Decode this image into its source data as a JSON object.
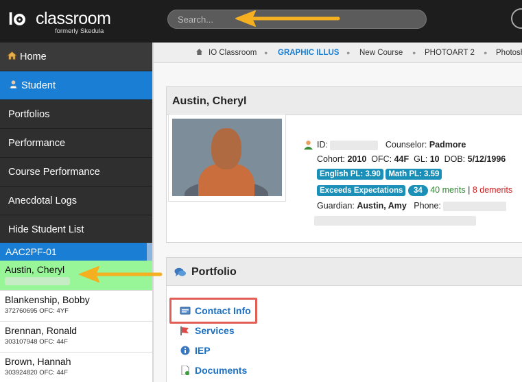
{
  "topbar": {
    "logo_io": "I",
    "logo_name": "classroom",
    "logo_sub": "formerly Skedula",
    "search_placeholder": "Search..."
  },
  "sidebar": {
    "items": [
      {
        "label": "Home",
        "icon": "home-icon"
      },
      {
        "label": "Student",
        "icon": "student-icon",
        "active": true
      },
      {
        "label": "Portfolios"
      },
      {
        "label": "Performance"
      },
      {
        "label": "Course Performance"
      },
      {
        "label": "Anecdotal Logs"
      },
      {
        "label": "Hide Student List"
      }
    ]
  },
  "student_list": {
    "header": "AAC2PF-01",
    "students": [
      {
        "name": "Austin, Cheryl",
        "sub": "",
        "selected": true
      },
      {
        "name": "Blankenship, Bobby",
        "sub": "372760695 OFC: 4YF"
      },
      {
        "name": "Brennan, Ronald",
        "sub": "303107948 OFC: 44F"
      },
      {
        "name": "Brown, Hannah",
        "sub": "303924820 OFC: 44F"
      }
    ]
  },
  "breadcrumbs": {
    "items": [
      "IO Classroom",
      "GRAPHIC ILLUS",
      "New Course",
      "PHOTOART 2",
      "Photosh"
    ],
    "active_index": 1
  },
  "student": {
    "name": "Austin, Cheryl",
    "id_label": "ID:",
    "counselor_label": "Counselor:",
    "counselor": "Padmore",
    "cohort_label": "Cohort:",
    "cohort": "2010",
    "ofc_label": "OFC:",
    "ofc": "44F",
    "gl_label": "GL:",
    "gl": "10",
    "dob_label": "DOB:",
    "dob": "5/12/1996",
    "english_pl": "English PL: 3.90",
    "math_pl": "Math PL: 3.59",
    "expectation": "Exceeds Expectations",
    "expectation_count": "34",
    "merits": "40 merits",
    "demerits": "8 demerits",
    "guardian_label": "Guardian:",
    "guardian": "Austin, Amy",
    "phone_label": "Phone:"
  },
  "portfolio": {
    "title": "Portfolio",
    "links": [
      {
        "label": "Contact Info",
        "icon": "contact-card-icon"
      },
      {
        "label": "Services",
        "icon": "flag-icon"
      },
      {
        "label": "IEP",
        "icon": "info-icon"
      },
      {
        "label": "Documents",
        "icon": "document-icon"
      }
    ]
  },
  "colors": {
    "accent": "#1a7fd4",
    "badge": "#1a8fb8",
    "selected_row": "#98f598",
    "highlight_box": "#e35d57",
    "arrow": "#f5b021"
  }
}
